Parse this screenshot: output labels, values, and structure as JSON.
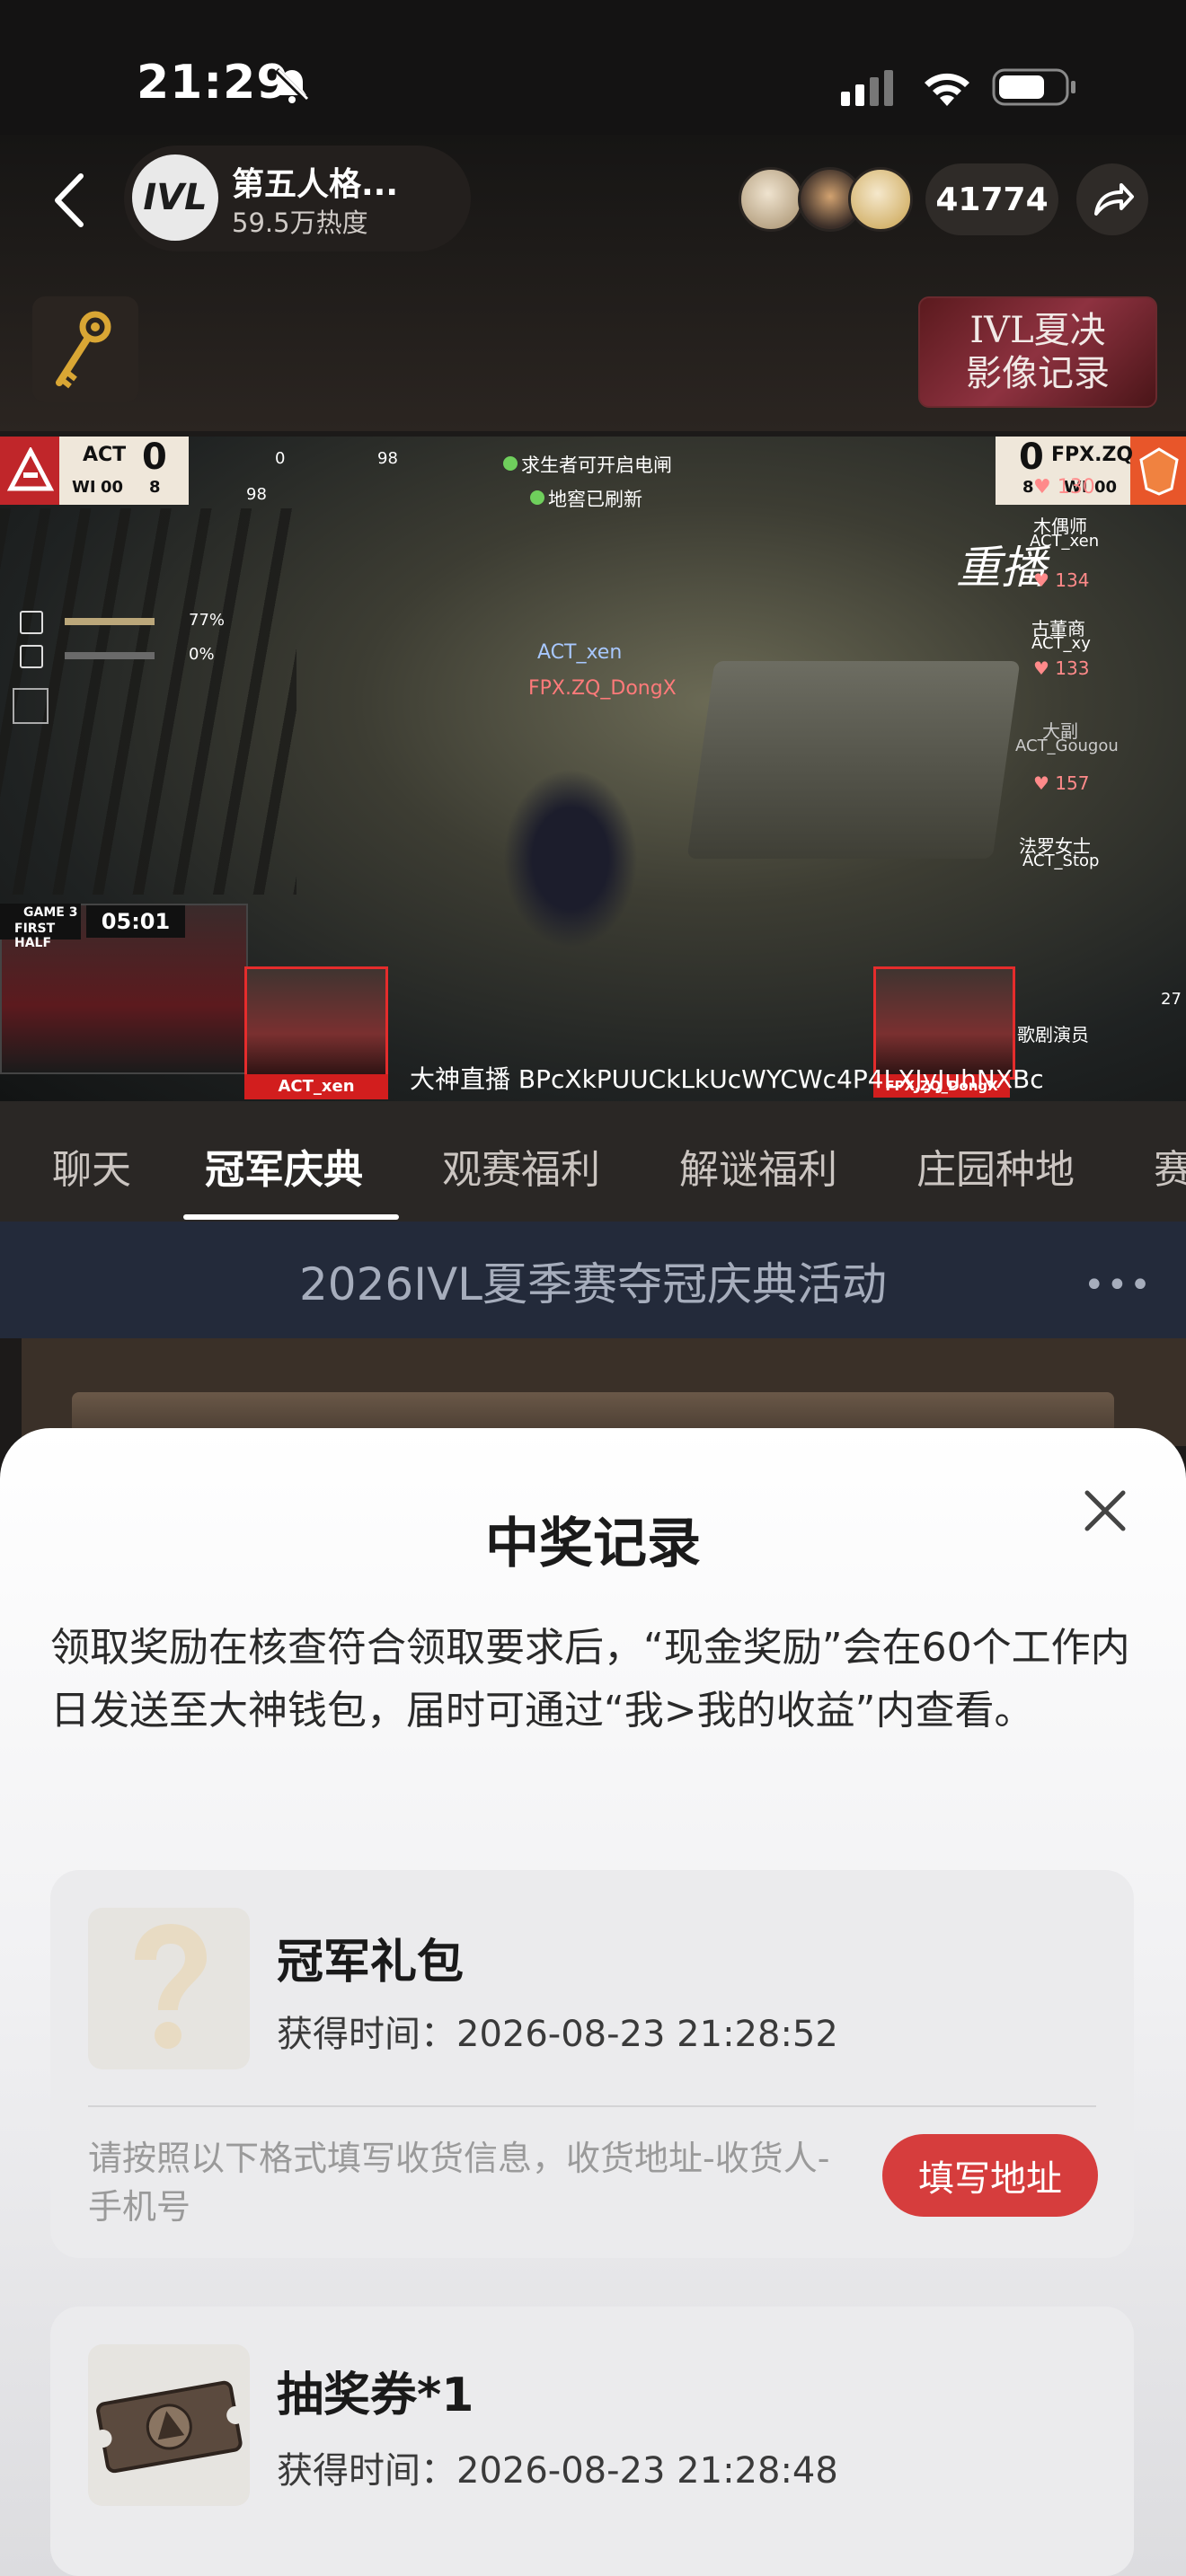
{
  "status_bar": {
    "time": "21:29"
  },
  "header": {
    "room_logo": "IVL",
    "room_title": "第五人格...",
    "room_heat": "59.5万热度",
    "viewer_count": "41774",
    "banner_line1": "IVL夏决",
    "banner_line2": "影像记录"
  },
  "video": {
    "left_team": {
      "name": "ACT",
      "score": "0",
      "sub1": "WI",
      "sub2": "00",
      "sub3": "8"
    },
    "right_team": {
      "name": "FPX.ZQ",
      "score": "0",
      "sub1": "8",
      "sub2": "WI",
      "sub3": "00"
    },
    "notice_1": "求生者可开启电闸",
    "notice_2": "地窖已刷新",
    "replay_label": "重播",
    "player_tag_1": "ACT_xen",
    "player_tag_2": "FPX.ZQ_DongX",
    "left_stat_1": "77%",
    "left_stat_2": "0%",
    "top_num_1": "0",
    "top_num_2": "98",
    "top_num_3": "98",
    "game_info_1": "GAME 3",
    "game_info_2": "FIRST HALF",
    "game_timer": "05:01",
    "survivors": [
      {
        "hp": "130",
        "role": "木偶师",
        "player": "ACT_xen"
      },
      {
        "hp": "134",
        "role": "古董商",
        "player": "ACT_xy"
      },
      {
        "hp": "133",
        "role": "大副",
        "player": "ACT_Gougou"
      },
      {
        "hp": "157",
        "role": "法罗女士",
        "player": "ACT_Stop"
      }
    ],
    "hunter_role": "歌剧演员",
    "hunter_num": "27",
    "cam_left_label": "ACT_xen",
    "cam_right_label": "FPX.ZQ_DongX",
    "watermark": "大神直播 BPcXkPUUCkLkUcWYCWc4P4LXJyJuhNXBc"
  },
  "tabs": [
    "聊天",
    "冠军庆典",
    "观赛福利",
    "解谜福利",
    "庄园种地",
    "赛"
  ],
  "active_tab": "冠军庆典",
  "event": {
    "title": "2026IVL夏季赛夺冠庆典活动",
    "more": "•••"
  },
  "sheet": {
    "title": "中奖记录",
    "notice": "领取奖励在核查符合领取要求后，“现金奖励”会在60个工作内日发送至大神钱包，届时可通过“我>我的收益”内查看。",
    "records": [
      {
        "name": "冠军礼包",
        "time": "获得时间：2026-08-23 21:28:52",
        "address_hint": "请按照以下格式填写收货信息，收货地址-收货人-手机号",
        "address_button": "填写地址"
      },
      {
        "name": "抽奖券*1",
        "time": "获得时间：2026-08-23 21:28:48"
      }
    ]
  },
  "colors": {
    "accent_red": "#d63d3d",
    "sheet_bg": "#ffffff",
    "event_bar": "#232a3a"
  }
}
